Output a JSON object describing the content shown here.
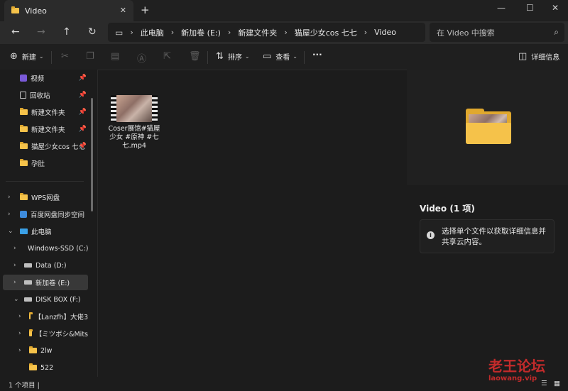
{
  "tab": {
    "title": "Video",
    "close_glyph": "✕",
    "new_tab_glyph": "+"
  },
  "window_controls": {
    "minimize": "—",
    "maximize": "☐",
    "close": "✕"
  },
  "nav": {
    "back": "←",
    "forward": "→",
    "up": "↑",
    "refresh": "↻"
  },
  "breadcrumb": [
    "此电脑",
    "新加卷 (E:)",
    "新建文件夹",
    "猫屋少女cos 七七",
    "Video"
  ],
  "search": {
    "placeholder": "在 Video 中搜索"
  },
  "toolbar": {
    "new_label": "新建",
    "sort_label": "排序",
    "view_label": "查看",
    "more_label": "···",
    "details_label": "详细信息"
  },
  "sidebar": {
    "quick_access": [
      {
        "label": "视频",
        "icon": "video-folder-icon",
        "pinned": true
      },
      {
        "label": "回收站",
        "icon": "recycle-bin-icon",
        "pinned": true
      },
      {
        "label": "新建文件夹",
        "icon": "folder-icon",
        "pinned": true
      },
      {
        "label": "新建文件夹",
        "icon": "folder-icon",
        "pinned": true
      },
      {
        "label": "猫屋少女cos 七七",
        "icon": "folder-icon",
        "pinned": true
      },
      {
        "label": "孕肚",
        "icon": "folder-icon",
        "pinned": false
      }
    ],
    "tree": [
      {
        "label": "WPS网盘",
        "icon": "folder-icon",
        "expanded": false,
        "indent": 0
      },
      {
        "label": "百度网盘同步空间",
        "icon": "cloud-sync-icon",
        "expanded": false,
        "indent": 0
      },
      {
        "label": "此电脑",
        "icon": "pc-icon",
        "expanded": true,
        "indent": 0
      },
      {
        "label": "Windows-SSD (C:)",
        "icon": "drive-icon",
        "expanded": false,
        "indent": 1
      },
      {
        "label": "Data (D:)",
        "icon": "drive-icon",
        "expanded": false,
        "indent": 1
      },
      {
        "label": "新加卷 (E:)",
        "icon": "drive-icon",
        "expanded": false,
        "indent": 1,
        "selected": true
      },
      {
        "label": "DISK BOX (F:)",
        "icon": "drive-icon",
        "expanded": true,
        "indent": 1
      },
      {
        "label": "【Lanzfh】大佬3",
        "icon": "folder-icon",
        "expanded": false,
        "indent": 2
      },
      {
        "label": "【ミツボシ&Mits",
        "icon": "folder-icon",
        "expanded": false,
        "indent": 2
      },
      {
        "label": "2lw",
        "icon": "folder-icon",
        "expanded": false,
        "indent": 2
      },
      {
        "label": "522",
        "icon": "folder-icon",
        "expanded": null,
        "indent": 2
      }
    ]
  },
  "files": [
    {
      "name": "Coser展馆#猫屋少女 #原神 #七七.mp4",
      "icon": "video-thumbnail-icon"
    }
  ],
  "details": {
    "title": "Video (1 项)",
    "info_text": "选择单个文件以获取详细信息并共享云内容。"
  },
  "status": {
    "text": "1 个项目  |"
  },
  "watermark": {
    "line1": "老王论坛",
    "line2": "laowang.vip"
  },
  "colors": {
    "folder": "#f5c24a",
    "accent": "#4ca0e0",
    "background": "#1c1c1c",
    "watermark": "#c22b2b"
  }
}
